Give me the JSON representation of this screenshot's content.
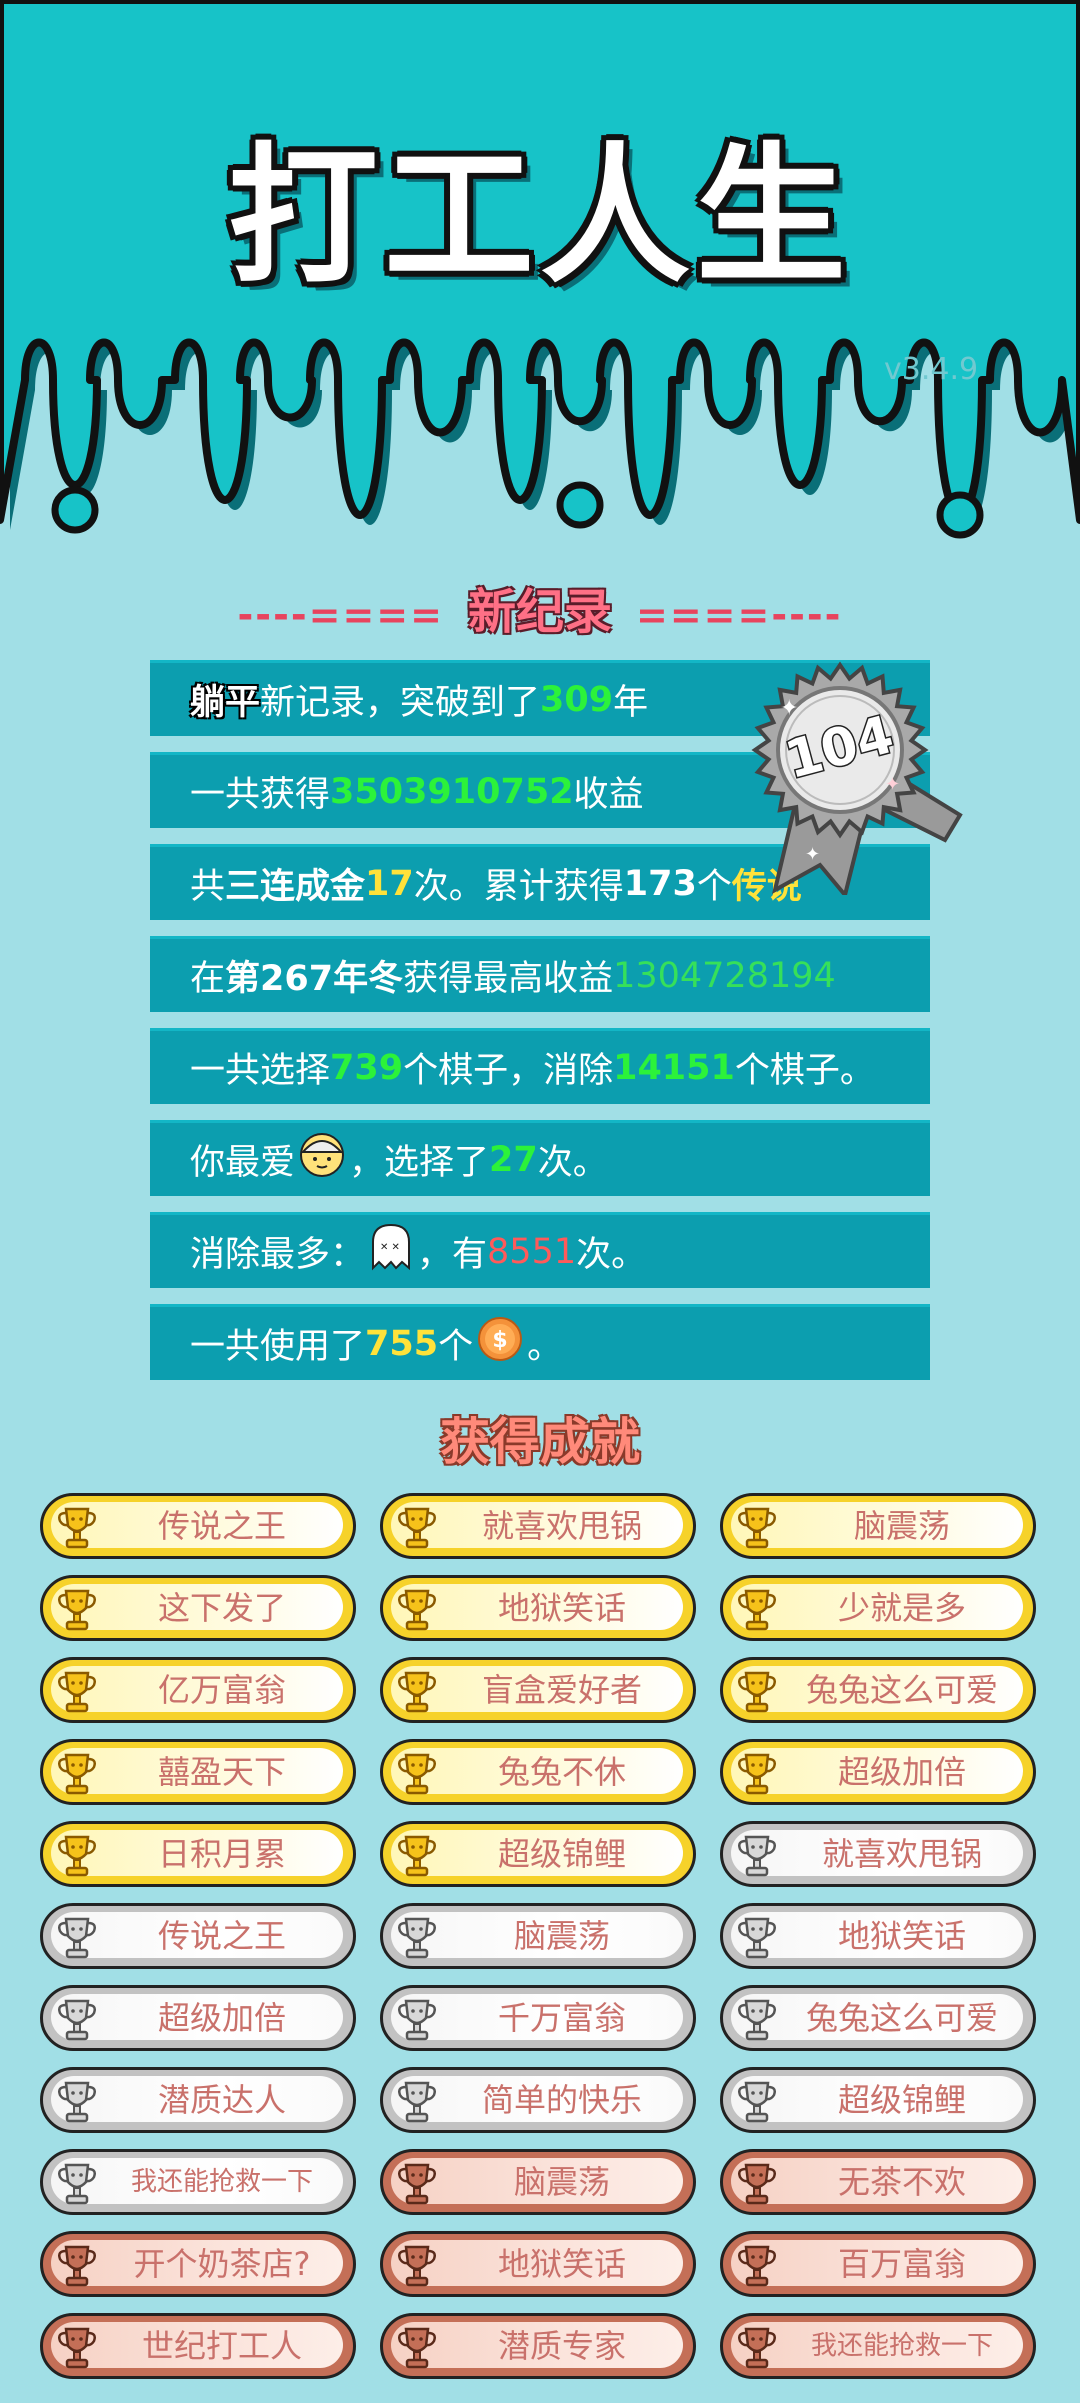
{
  "title": "打工人生",
  "version": "v3.4.9",
  "record": {
    "heading_left": "----====",
    "heading": "新纪录",
    "heading_right": "====----",
    "badge_number": "104",
    "stats": [
      {
        "parts": [
          {
            "t": "躺平",
            "c": "outlined"
          },
          {
            "t": "新记录，突破到了",
            "c": ""
          },
          {
            "t": "309",
            "c": "g"
          },
          {
            "t": "年",
            "c": ""
          }
        ]
      },
      {
        "parts": [
          {
            "t": "一共获得",
            "c": ""
          },
          {
            "t": "3503910752",
            "c": "g"
          },
          {
            "t": "收益",
            "c": ""
          }
        ]
      },
      {
        "parts": [
          {
            "t": "共",
            "c": ""
          },
          {
            "t": "三连成金",
            "c": "w"
          },
          {
            "t": "17",
            "c": "y"
          },
          {
            "t": "次。累计获得",
            "c": ""
          },
          {
            "t": "173",
            "c": "w"
          },
          {
            "t": "个",
            "c": ""
          },
          {
            "t": "传说",
            "c": "y"
          }
        ]
      },
      {
        "parts": [
          {
            "t": "在 ",
            "c": ""
          },
          {
            "t": "第267年冬",
            "c": "w"
          },
          {
            "t": " 获得最高收益",
            "c": ""
          },
          {
            "t": "1304728194",
            "c": "lg"
          }
        ]
      },
      {
        "parts": [
          {
            "t": "一共选择",
            "c": ""
          },
          {
            "t": "739",
            "c": "g"
          },
          {
            "t": "个棋子，消除",
            "c": ""
          },
          {
            "t": "14151",
            "c": "g"
          },
          {
            "t": "个棋子。",
            "c": ""
          }
        ]
      },
      {
        "parts": [
          {
            "t": "你最爱",
            "c": ""
          },
          {
            "icon": "worker-face-icon"
          },
          {
            "t": "，选择了",
            "c": ""
          },
          {
            "t": "27",
            "c": "g"
          },
          {
            "t": "次。",
            "c": ""
          }
        ]
      },
      {
        "parts": [
          {
            "t": "消除最多：",
            "c": ""
          },
          {
            "icon": "ghost-icon"
          },
          {
            "t": "，有",
            "c": ""
          },
          {
            "t": "8551",
            "c": "r"
          },
          {
            "t": "次。",
            "c": ""
          }
        ]
      },
      {
        "parts": [
          {
            "t": "一共使用了",
            "c": ""
          },
          {
            "t": "755",
            "c": "y"
          },
          {
            "t": "个",
            "c": ""
          },
          {
            "icon": "coin-icon"
          },
          {
            "t": "。",
            "c": ""
          }
        ]
      }
    ]
  },
  "achievements": {
    "heading": "获得成就",
    "items": [
      {
        "label": "传说之王",
        "tier": "gold"
      },
      {
        "label": "就喜欢甩锅",
        "tier": "gold"
      },
      {
        "label": "脑震荡",
        "tier": "gold"
      },
      {
        "label": "这下发了",
        "tier": "gold"
      },
      {
        "label": "地狱笑话",
        "tier": "gold"
      },
      {
        "label": "少就是多",
        "tier": "gold"
      },
      {
        "label": "亿万富翁",
        "tier": "gold"
      },
      {
        "label": "盲盒爱好者",
        "tier": "gold"
      },
      {
        "label": "兔兔这么可爱",
        "tier": "gold"
      },
      {
        "label": "囍盈天下",
        "tier": "gold"
      },
      {
        "label": "兔兔不休",
        "tier": "gold"
      },
      {
        "label": "超级加倍",
        "tier": "gold"
      },
      {
        "label": "日积月累",
        "tier": "gold"
      },
      {
        "label": "超级锦鲤",
        "tier": "gold"
      },
      {
        "label": "就喜欢甩锅",
        "tier": "silver"
      },
      {
        "label": "传说之王",
        "tier": "silver"
      },
      {
        "label": "脑震荡",
        "tier": "silver"
      },
      {
        "label": "地狱笑话",
        "tier": "silver"
      },
      {
        "label": "超级加倍",
        "tier": "silver"
      },
      {
        "label": "千万富翁",
        "tier": "silver"
      },
      {
        "label": "兔兔这么可爱",
        "tier": "silver"
      },
      {
        "label": "潜质达人",
        "tier": "silver"
      },
      {
        "label": "简单的快乐",
        "tier": "silver"
      },
      {
        "label": "超级锦鲤",
        "tier": "silver"
      },
      {
        "label": "我还能抢救一下",
        "tier": "silver"
      },
      {
        "label": "脑震荡",
        "tier": "bronze"
      },
      {
        "label": "无茶不欢",
        "tier": "bronze"
      },
      {
        "label": "开个奶茶店?",
        "tier": "bronze"
      },
      {
        "label": "地狱笑话",
        "tier": "bronze"
      },
      {
        "label": "百万富翁",
        "tier": "bronze"
      },
      {
        "label": "世纪打工人",
        "tier": "bronze"
      },
      {
        "label": "潜质专家",
        "tier": "bronze"
      },
      {
        "label": "我还能抢救一下",
        "tier": "bronze"
      }
    ]
  },
  "colors": {
    "top_bg": "#17c3c8",
    "page_bg": "#a1dfe6",
    "stat_row": "#0c9eaf",
    "gold": "#f6d22a",
    "silver": "#c2c2c2",
    "bronze": "#c46f57"
  }
}
